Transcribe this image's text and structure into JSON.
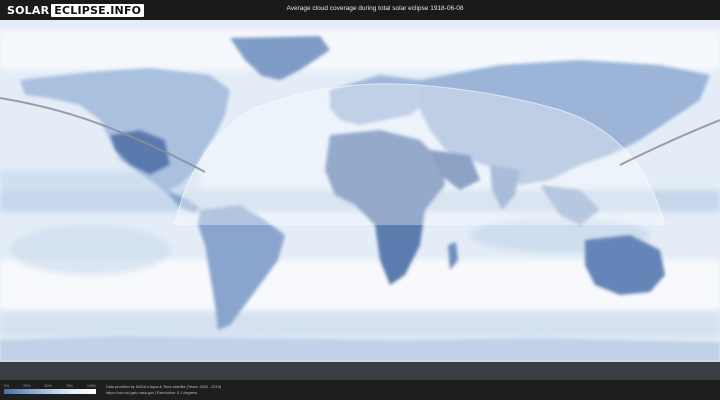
{
  "header": {
    "logo_part_a": "SOLAR",
    "logo_part_b": "ECLIPSE.INFO",
    "title": "Average cloud coverage during total solar eclipse 1918-06-08"
  },
  "legend": {
    "ticks": [
      "0%",
      "25%",
      "50%",
      "75%",
      "100%"
    ],
    "colors": [
      "#4b6ea3",
      "#7f9ec8",
      "#b5cbe6",
      "#e6eef8",
      "#ffffff"
    ]
  },
  "footer": {
    "credit_line_1": "Data provided by NASA's Aqua & Terra satellite (Years: 2000 - 2019)",
    "credit_line_2": "https://neo.sci.gsfc.nasa.gov | Resolution: 0.1 degrees"
  },
  "colors": {
    "ocean_cloud": "#e3ecf6",
    "land": "#6f8fbd",
    "visibility_zone": "#ffffff",
    "eclipse_path": "#8a8f99"
  }
}
